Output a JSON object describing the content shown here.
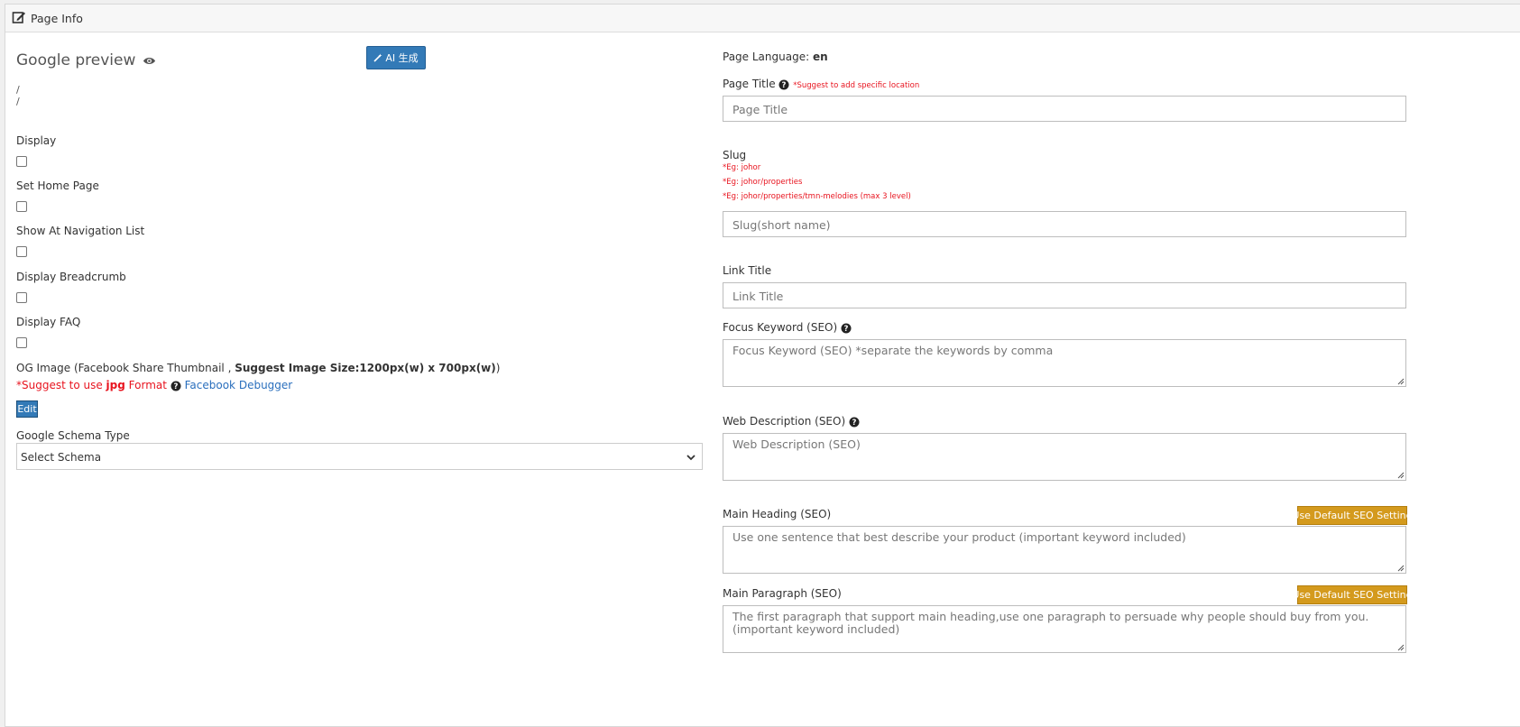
{
  "header": {
    "title": "Page Info",
    "icon": "edit-icon"
  },
  "left": {
    "google_preview_title": "Google preview",
    "ai_button": "AI 生成",
    "preview_lines": [
      "/",
      "/"
    ],
    "checkboxes": [
      {
        "label": "Display",
        "checked": false
      },
      {
        "label": "Set Home Page",
        "checked": false
      },
      {
        "label": "Show At Navigation List",
        "checked": false
      },
      {
        "label": "Display Breadcrumb",
        "checked": false
      },
      {
        "label": "Display FAQ",
        "checked": false
      }
    ],
    "og_image": {
      "label_prefix": "OG Image (Facebook Share Thumbnail ,",
      "label_bold": "Suggest Image Size:1200px(w) x 700px(w)",
      "label_suffix": ")",
      "suggest_prefix": "*Suggest to use",
      "suggest_bold": "jpg",
      "suggest_suffix": "Format",
      "debugger_link": "Facebook Debugger",
      "edit_button": "Edit"
    },
    "schema": {
      "label": "Google Schema Type",
      "selected": "Select Schema"
    }
  },
  "right": {
    "page_language_label": "Page Language:",
    "page_language_value": "en",
    "page_title": {
      "label": "Page Title",
      "hint": "*Suggest to add specific location",
      "placeholder": "Page Title"
    },
    "slug": {
      "label": "Slug",
      "examples": [
        "*Eg: johor",
        "*Eg: johor/properties",
        "*Eg: johor/properties/tmn-melodies (max 3 level)"
      ],
      "placeholder": "Slug(short name)"
    },
    "link_title": {
      "label": "Link Title",
      "placeholder": "Link Title"
    },
    "focus_keyword": {
      "label": "Focus Keyword (SEO)",
      "placeholder": "Focus Keyword (SEO) *separate the keywords by comma"
    },
    "web_description": {
      "label": "Web Description (SEO)",
      "placeholder": "Web Description (SEO)"
    },
    "main_heading": {
      "label": "Main Heading (SEO)",
      "button": "Use Default SEO Setting",
      "placeholder": "Use one sentence that best describe your product (important keyword included)"
    },
    "main_paragraph": {
      "label": "Main Paragraph (SEO)",
      "button": "Use Default SEO Setting",
      "placeholder": "The first paragraph that support main heading,use one paragraph to persuade why people should buy from you. (important keyword included)"
    }
  },
  "colors": {
    "primary": "#337ab7",
    "warning": "#d49a1d",
    "danger": "#e8141f",
    "link": "#2a6fbd"
  }
}
